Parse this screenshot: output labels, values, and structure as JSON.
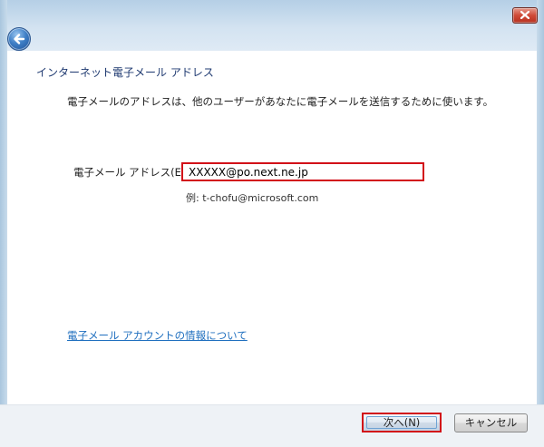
{
  "window": {
    "close_icon": "close-icon",
    "back_icon": "back-arrow-icon"
  },
  "page": {
    "heading": "インターネット電子メール アドレス",
    "description": "電子メールのアドレスは、他のユーザーがあなたに電子メールを送信するために使います。"
  },
  "form": {
    "email_label": "電子メール アドレス(E):",
    "email_value": "XXXXX@po.next.ne.jp",
    "example": "例: t-chofu@microsoft.com"
  },
  "links": {
    "account_info": "電子メール アカウントの情報について"
  },
  "buttons": {
    "next": "次へ(N)",
    "cancel": "キャンセル"
  },
  "colors": {
    "highlight": "#d20f18",
    "link": "#1f6fbf",
    "heading": "#1e3970"
  }
}
